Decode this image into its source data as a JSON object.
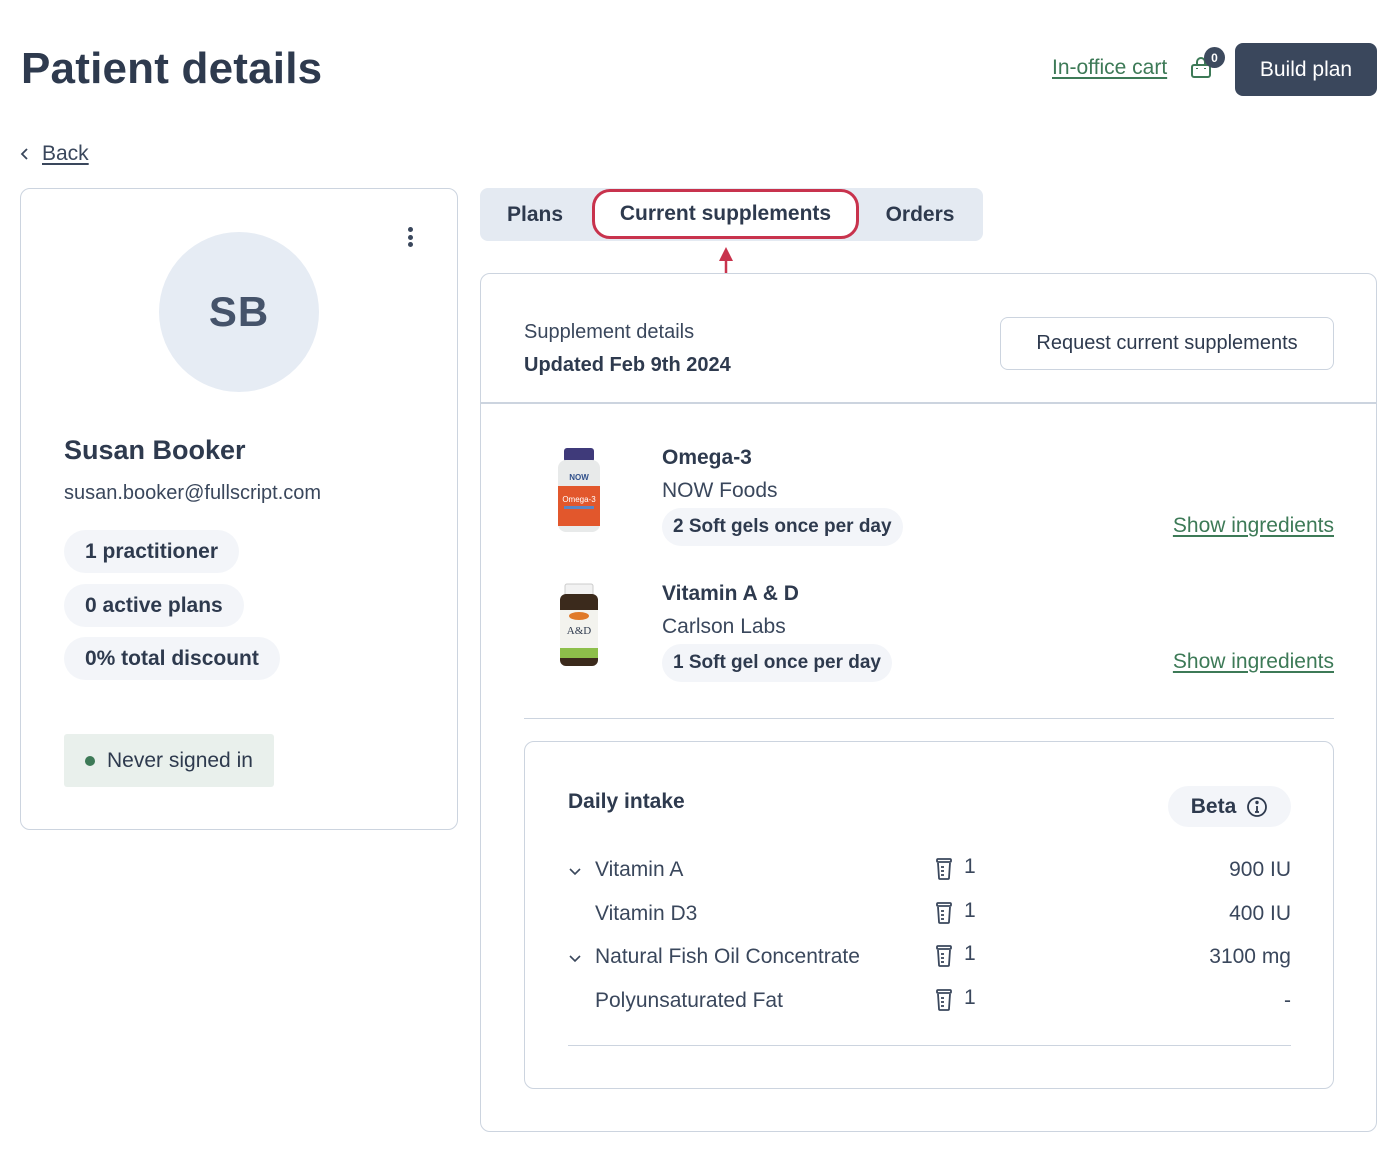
{
  "header": {
    "title": "Patient details",
    "cart_link": "In-office cart",
    "cart_count": "0",
    "build_plan": "Build plan"
  },
  "back": {
    "label": "Back"
  },
  "patient": {
    "initials": "SB",
    "name": "Susan Booker",
    "email": "susan.booker@fullscript.com",
    "pills": [
      "1 practitioner",
      "0 active plans",
      "0% total discount"
    ],
    "status": "Never signed in"
  },
  "tabs": [
    {
      "label": "Plans",
      "active": false
    },
    {
      "label": "Current supplements",
      "active": true
    },
    {
      "label": "Orders",
      "active": false
    }
  ],
  "panel": {
    "subtitle": "Supplement details",
    "updated": "Updated Feb 9th 2024",
    "request_button": "Request current supplements",
    "supplements": [
      {
        "name": "Omega-3",
        "brand": "NOW Foods",
        "dosage": "2 Soft gels once per day",
        "link": "Show ingredients"
      },
      {
        "name": "Vitamin A & D",
        "brand": "Carlson Labs",
        "dosage": "1 Soft gel once per day",
        "link": "Show ingredients"
      }
    ],
    "daily_intake": {
      "title": "Daily intake",
      "badge": "Beta",
      "rows": [
        {
          "name": "Vitamin A",
          "expandable": true,
          "count": "1",
          "amount": "900 IU"
        },
        {
          "name": "Vitamin D3",
          "expandable": false,
          "count": "1",
          "amount": "400 IU"
        },
        {
          "name": "Natural Fish Oil Concentrate",
          "expandable": true,
          "count": "1",
          "amount": "3100 mg"
        },
        {
          "name": "Polyunsaturated Fat",
          "expandable": false,
          "count": "1",
          "amount": "-"
        }
      ]
    }
  },
  "colors": {
    "accent_green": "#3d7a57",
    "primary_dark": "#3a475c",
    "highlight_red": "#c8334d"
  }
}
